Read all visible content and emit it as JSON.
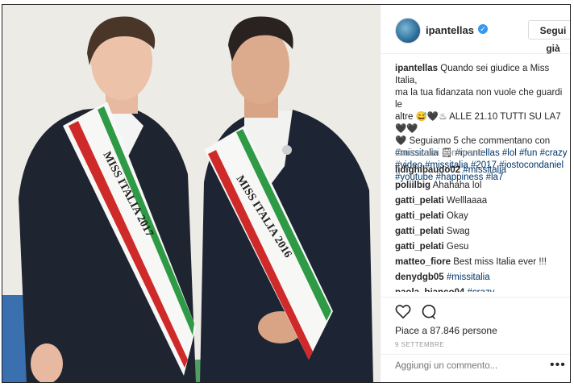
{
  "post": {
    "username": "ipantellas",
    "verified_icon": "verified-badge-icon",
    "follow_label": "Segui già",
    "caption_user": "ipantellas",
    "caption_lines": [
      "Quando sei giudice a Miss Italia,",
      "ma la tua fidanzata non vuole che guardi le",
      "altre 😅🖤♨ ALLE 21.10 TUTTI SU LA7 🖤🖤",
      "🖤 Seguiamo 5 che commentano con",
      "#missitalia 🗒 #ipantellas #lol #fun #crazy",
      "#video #missitalia #2017 #iostocondaniel",
      "#youtube #happiness #la7"
    ],
    "load_more": "Carica altri commenti",
    "comments": [
      {
        "user": "lidighibaudo02",
        "text": "#missitalia"
      },
      {
        "user": "poliilbig",
        "text": "Ahahaha lol"
      },
      {
        "user": "gatti_pelati",
        "text": "Welllaaaa"
      },
      {
        "user": "gatti_pelati",
        "text": "Okay"
      },
      {
        "user": "gatti_pelati",
        "text": "Swag"
      },
      {
        "user": "gatti_pelati",
        "text": "Gesu"
      },
      {
        "user": "matteo_fiore",
        "text": "Best miss Italia ever !!!"
      },
      {
        "user": "denydgb05",
        "text": "#missitalia"
      },
      {
        "user": "paola_bianco04",
        "text": "#crazy"
      }
    ],
    "likes": "Piace a 87.846 persone",
    "date": "9 SETTEMBRE",
    "add_comment_placeholder": "Aggiungi un commento...",
    "more_label": "•••"
  },
  "photo": {
    "sash_left": "MISS ITALIA 2017",
    "sash_right": "MISS ITALIA 2016"
  }
}
